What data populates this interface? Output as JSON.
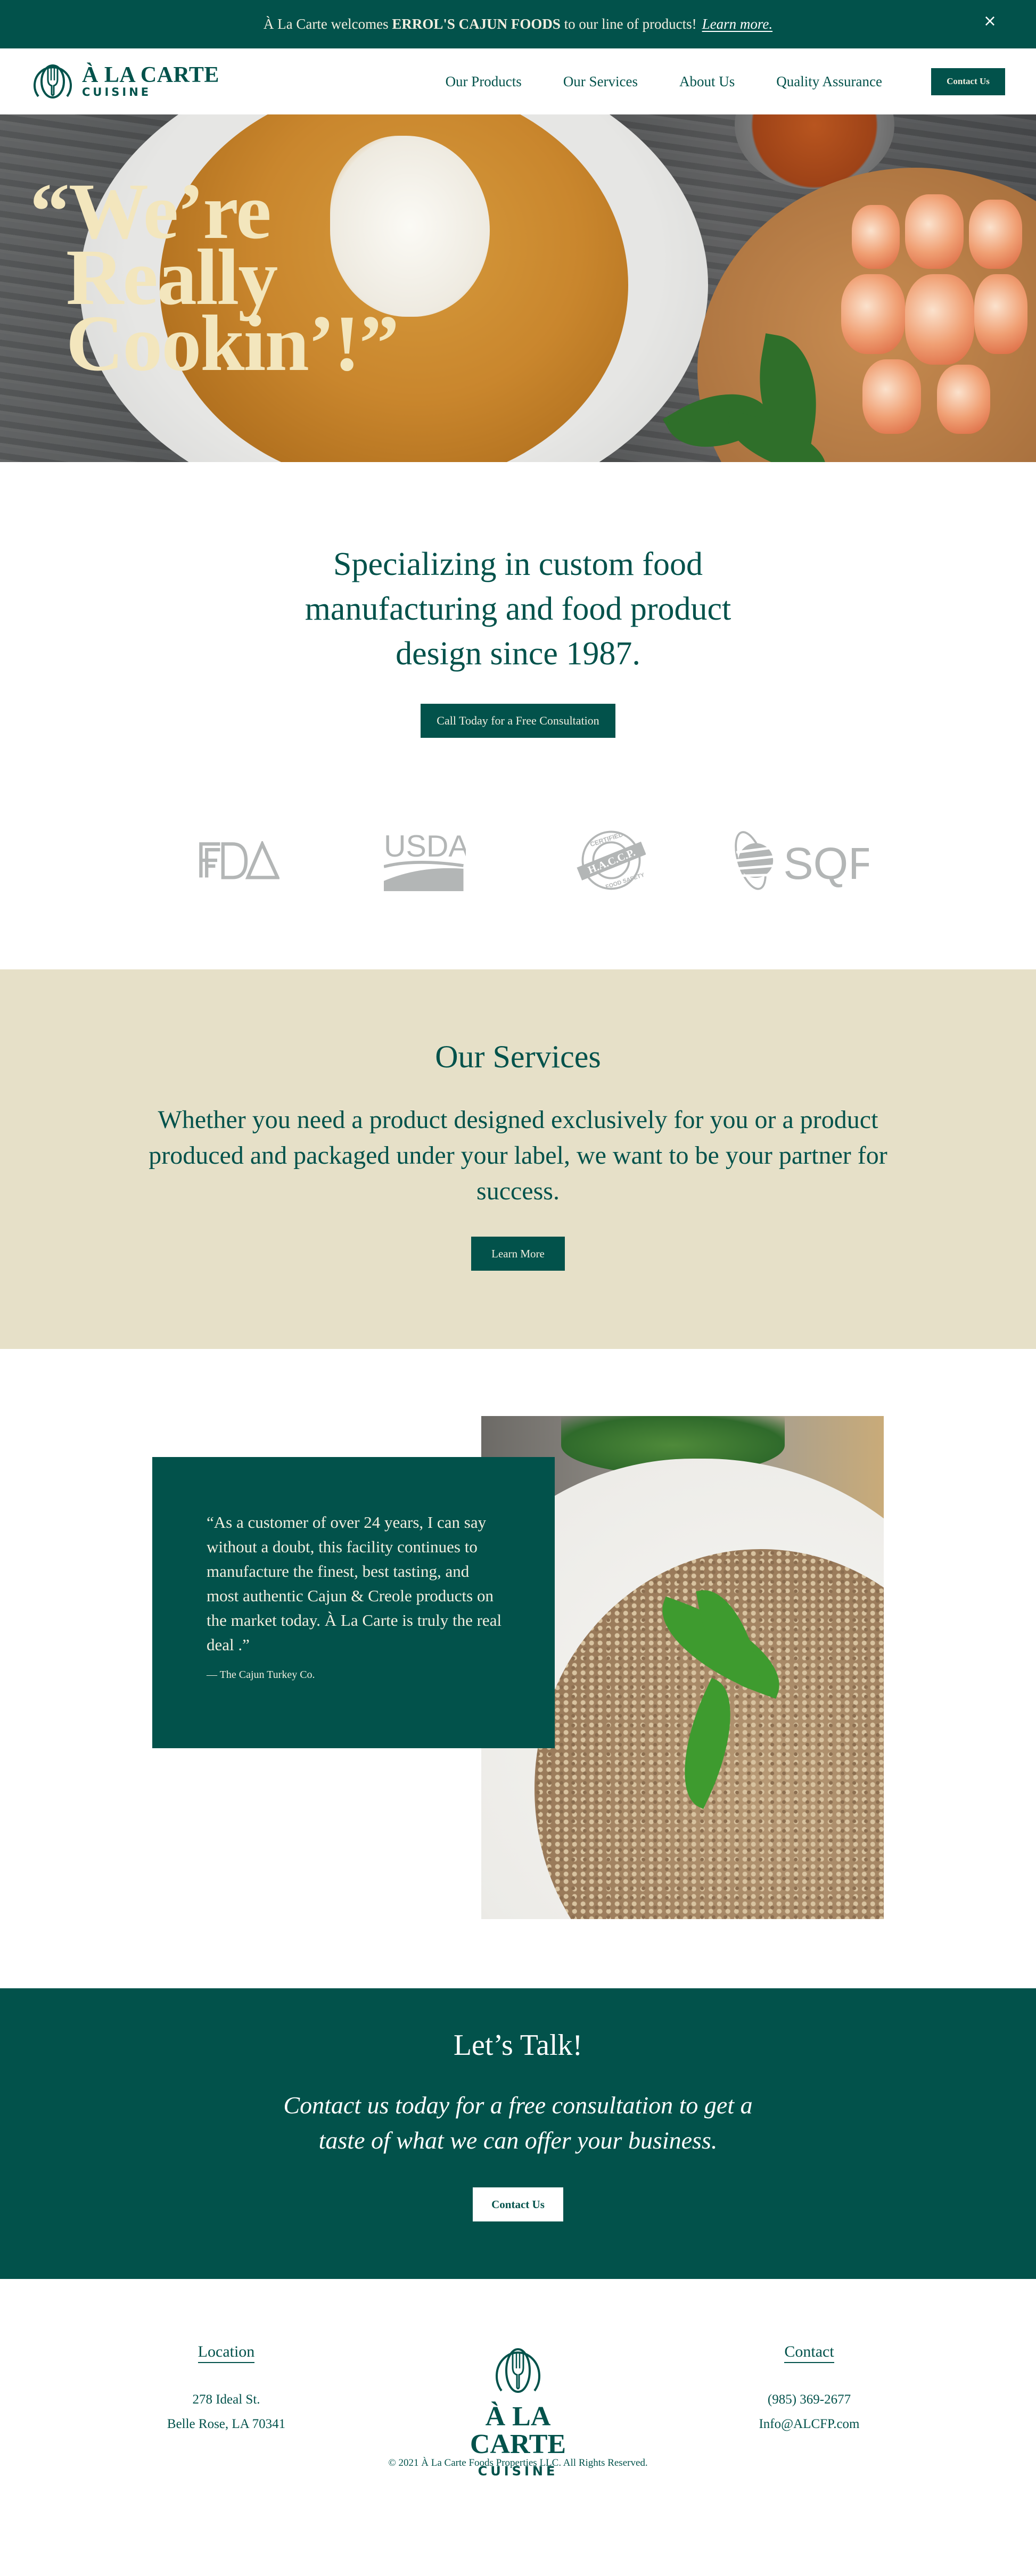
{
  "brand": {
    "name_line1": "À LA CARTE",
    "name_line2": "CUISINE",
    "primary_color": "#02524b",
    "beige_color": "#e6e0c8",
    "cream_color": "#f3e6bd"
  },
  "announcement": {
    "prefix": "À La Carte welcomes ",
    "highlight": "ERROL'S CAJUN FOODS",
    "suffix": " to our line of products!",
    "link": "Learn more.",
    "close_icon": "close-icon",
    "close_label": "×"
  },
  "nav": {
    "items": [
      {
        "label": "Our Products"
      },
      {
        "label": "Our Services"
      },
      {
        "label": "About Us"
      },
      {
        "label": "Quality Assurance"
      }
    ],
    "contact_label": "Contact Us"
  },
  "hero": {
    "line1": "“We’re",
    "line2": "Really",
    "line3": "Cookin’!”"
  },
  "intro": {
    "heading": "Specializing in custom food manufacturing and food product design since 1987.",
    "cta_label": "Call Today for a Free Consultation"
  },
  "certifications": [
    {
      "name": "FDA",
      "icon": "fda-logo-icon"
    },
    {
      "name": "USDA",
      "icon": "usda-logo-icon"
    },
    {
      "name": "H.A.C.C.P.",
      "top_text": "CERTIFIED",
      "bottom_text": "FOOD SAFETY",
      "icon": "haccp-logo-icon"
    },
    {
      "name": "SQF",
      "icon": "sqf-logo-icon"
    }
  ],
  "services": {
    "heading": "Our Services",
    "body": "Whether you need a product designed exclusively for you or a product produced and packaged under your label, we want to be your partner for success.",
    "cta_label": "Learn More"
  },
  "testimonial": {
    "quote": "“As a customer of over 24 years, I can say without a doubt, this facility continues to manufacture the finest, best tasting, and most authentic Cajun & Creole products on the market today. À La Carte is truly the real deal .”",
    "attribution": "— The Cajun Turkey Co."
  },
  "talk": {
    "heading": "Let’s Talk!",
    "body": "Contact us today for a free consultation to get a taste of what we can offer your business.",
    "cta_label": "Contact Us"
  },
  "footer": {
    "location": {
      "heading": "Location",
      "lines": [
        "278 Ideal St.",
        "Belle Rose, LA 70341"
      ]
    },
    "contact": {
      "heading": "Contact",
      "lines": [
        "(985) 369-2677",
        "Info@ALCFP.com"
      ]
    },
    "copyright": "© 2021 À La Carte Foods Properties  LLC. All Rights Reserved."
  }
}
